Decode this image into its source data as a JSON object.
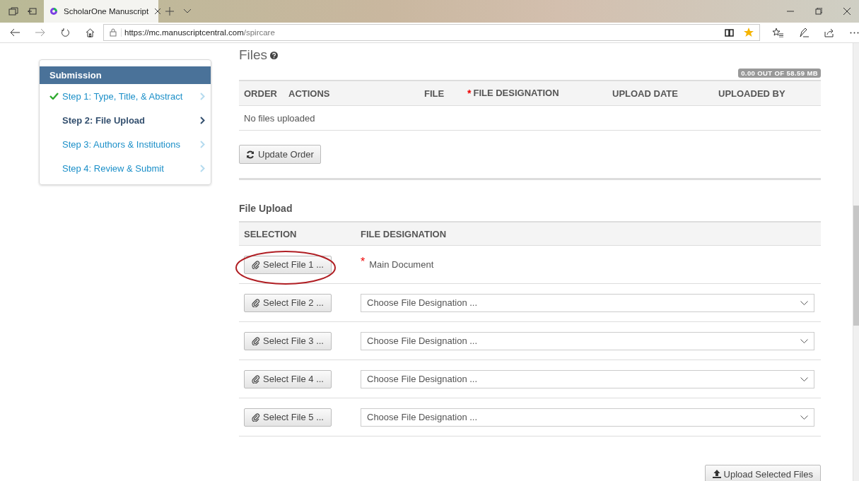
{
  "browser": {
    "tab_title": "ScholarOne Manuscript",
    "url_host": "https://mc.manuscriptcentral.com",
    "url_path": "/spircare"
  },
  "sidebar": {
    "title": "Submission",
    "steps": [
      {
        "label": "Step 1: Type, Title, & Abstract",
        "completed": true,
        "selected": false
      },
      {
        "label": "Step 2: File Upload",
        "completed": false,
        "selected": true
      },
      {
        "label": "Step 3: Authors & Institutions",
        "completed": false,
        "selected": false
      },
      {
        "label": "Step 4: Review & Submit",
        "completed": false,
        "selected": false
      }
    ]
  },
  "files": {
    "title": "Files",
    "storage": "0.00 OUT OF 58.59 MB",
    "columns": [
      {
        "label": "ORDER"
      },
      {
        "label": "ACTIONS"
      },
      {
        "label": "FILE"
      },
      {
        "label": "FILE DESIGNATION",
        "required_mark": "*"
      },
      {
        "label": "UPLOAD DATE"
      },
      {
        "label": "UPLOADED BY"
      }
    ],
    "empty_message": "No files uploaded",
    "update_button": "Update Order"
  },
  "upload": {
    "title": "File Upload",
    "columns": [
      "SELECTION",
      "FILE DESIGNATION"
    ],
    "rows": [
      {
        "kind": "fixed",
        "button": "Select File 1 ...",
        "required_mark": "*",
        "designation": "Main Document",
        "highlighted": true
      },
      {
        "kind": "dropdown",
        "button": "Select File 2 ...",
        "placeholder": "Choose File Designation ...",
        "highlighted": false
      },
      {
        "kind": "dropdown",
        "button": "Select File 3 ...",
        "placeholder": "Choose File Designation ...",
        "highlighted": false
      },
      {
        "kind": "dropdown",
        "button": "Select File 4 ...",
        "placeholder": "Choose File Designation ...",
        "highlighted": false
      },
      {
        "kind": "dropdown",
        "button": "Select File 5 ...",
        "placeholder": "Choose File Designation ...",
        "highlighted": false
      }
    ],
    "submit_button": "Upload Selected Files"
  }
}
